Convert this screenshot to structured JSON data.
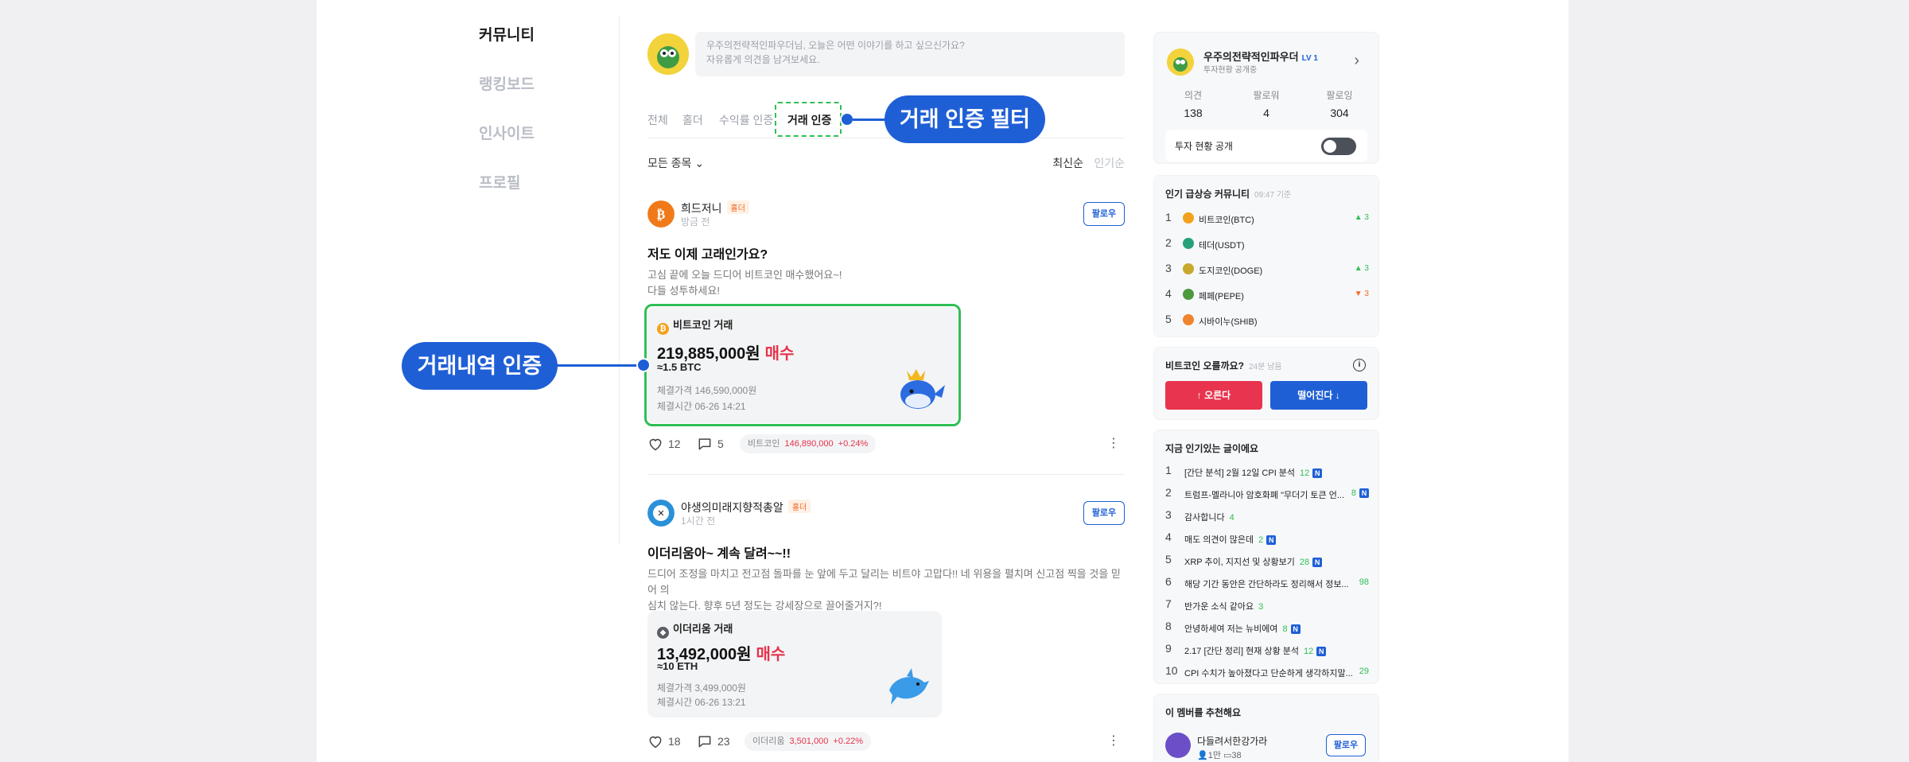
{
  "nav": {
    "items": [
      "커뮤니티",
      "랭킹보드",
      "인사이트",
      "프로필"
    ]
  },
  "composer": {
    "placeholder_line1": "우주의전략적인파우더님, 오늘은 어떤 이야기를 하고 싶으신가요?",
    "placeholder_line2": "자유롭게 의견을 남겨보세요."
  },
  "tabs": [
    "전체",
    "홀더",
    "수익률 인증",
    "거래 인증"
  ],
  "filter": {
    "selector": "모든 종목",
    "sort_latest": "최신순",
    "sort_popular": "인기순"
  },
  "posts": [
    {
      "user": "희드저니",
      "badge": "홀더",
      "time": "방금 전",
      "follow": "팔로우",
      "title": "저도 이제 고래인가요?",
      "body_line1": "고심 끝에 오늘 드디어 비트코인 매수했어요~!",
      "body_line2": "다들 성투하세요!",
      "trade": {
        "name": "비트코인 거래",
        "amount": "219,885,000원",
        "side": "매수",
        "qty": "≈1.5 BTC",
        "price": "체결가격 146,590,000원",
        "time": "체결시간 06-26 14:21"
      },
      "likes": "12",
      "comments": "5",
      "chip": {
        "coin": "비트코인",
        "price": "146,890,000",
        "change": "+0.24%"
      }
    },
    {
      "user": "야생의미래지향적총알",
      "badge": "홀더",
      "time": "1시간 전",
      "follow": "팔로우",
      "title": "이더리움아~ 계속 달려~~!!",
      "body_line1": "드디어 조정을 마치고 전고점 돌파를 눈 앞에 두고 달리는 비트야 고맙다!! 네 위용을 펼치며 신고점 찍을 것을 믿어 의",
      "body_line2": "심치 않는다. 향후 5년 정도는 강세장으로 끌어줄거지?!",
      "trade": {
        "name": "이더리움 거래",
        "amount": "13,492,000원",
        "side": "매수",
        "qty": "≈10 ETH",
        "price": "체결가격 3,499,000원",
        "time": "체결시간 06-26 13:21"
      },
      "likes": "18",
      "comments": "23",
      "chip": {
        "coin": "이더리움",
        "price": "3,501,000",
        "change": "+0.22%"
      }
    }
  ],
  "profile": {
    "name": "우주의전략적인파우더",
    "level": "LV 1",
    "sub": "투자현황 공개중",
    "stats": [
      {
        "k": "의견",
        "v": "138"
      },
      {
        "k": "팔로워",
        "v": "4"
      },
      {
        "k": "팔로잉",
        "v": "304"
      }
    ],
    "toggle_label": "투자 현황 공개"
  },
  "trending": {
    "title": "인기 급상승 커뮤니티",
    "time": "09:47 기준",
    "items": [
      {
        "n": "1",
        "name": "비트코인(BTC)",
        "change": "▲ 3",
        "dir": "up"
      },
      {
        "n": "2",
        "name": "테더(USDT)",
        "change": "",
        "dir": ""
      },
      {
        "n": "3",
        "name": "도지코인(DOGE)",
        "change": "▲ 3",
        "dir": "up"
      },
      {
        "n": "4",
        "name": "페페(PEPE)",
        "change": "▼ 3",
        "dir": "dn"
      },
      {
        "n": "5",
        "name": "시바이누(SHIB)",
        "change": "",
        "dir": ""
      }
    ]
  },
  "vote": {
    "question": "비트코인 오를까요?",
    "remain": "24분 남음",
    "up": "↑ 오른다",
    "down": "떨어진다 ↓"
  },
  "hot": {
    "title": "지금 인기있는 글이에요",
    "items": [
      {
        "n": "1",
        "t": "[간단 분석] 2월 12일 CPI 분석",
        "c": "12",
        "new": true
      },
      {
        "n": "2",
        "t": "트럼프-멜라니아 암호화폐 \"무더기 토큰 언...",
        "c": "8",
        "new": true
      },
      {
        "n": "3",
        "t": "감사합니다",
        "c": "4",
        "new": false
      },
      {
        "n": "4",
        "t": "매도 의견이 많은데",
        "c": "2",
        "new": true
      },
      {
        "n": "5",
        "t": "XRP 추이, 지지선 및 상황보기",
        "c": "28",
        "new": true
      },
      {
        "n": "6",
        "t": "해당 기간 동안은 간단하라도 정리해서 정보...",
        "c": "98",
        "new": false
      },
      {
        "n": "7",
        "t": "반가운 소식 같아요",
        "c": "3",
        "new": false
      },
      {
        "n": "8",
        "t": "안녕하세여 저는 뉴비에여",
        "c": "8",
        "new": true
      },
      {
        "n": "9",
        "t": "2.17 [간단 정리] 현재 상황 분석",
        "c": "12",
        "new": true
      },
      {
        "n": "10",
        "t": "CPI 수치가 높아졌다고 단순하게 생각하지말...",
        "c": "29",
        "new": false
      }
    ]
  },
  "recommend": {
    "title": "이 멤버를 추천해요",
    "name": "다들려서한강가라",
    "followers": "1만",
    "posts": "38",
    "follow": "팔로우"
  },
  "callouts": {
    "filter": "거래 인증 필터",
    "proof": "거래내역 인증"
  },
  "colors": {
    "accent": "#1f5fd6",
    "highlight": "#2fbf55",
    "buy": "#e5334a",
    "vote_up": "#e8344e"
  }
}
